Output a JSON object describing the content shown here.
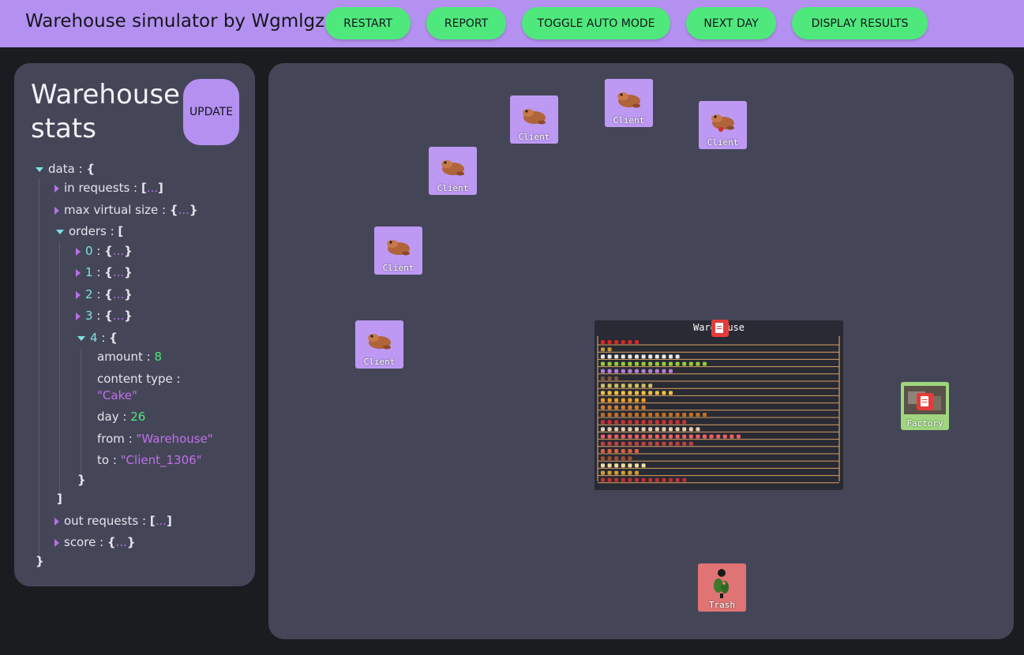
{
  "header": {
    "title": "Warehouse simulator by Wgmlgz",
    "buttons": {
      "restart": "RESTART",
      "report": "REPORT",
      "toggle_auto": "TOGGLE AUTO MODE",
      "next_day": "NEXT DAY",
      "display_results": "DISPLAY RESULTS"
    }
  },
  "stats": {
    "title": "Warehouse stats",
    "update_label": "UPDATE",
    "tree": {
      "data_key": "data",
      "in_requests_key": "in requests",
      "max_virtual_size_key": "max virtual size",
      "orders_key": "orders",
      "order_indexes": [
        "0",
        "1",
        "2",
        "3"
      ],
      "expanded_index": "4",
      "expanded_order": {
        "amount_key": "amount",
        "amount": "8",
        "content_type_key": "content type",
        "content_type": "\"Cake\"",
        "day_key": "day",
        "day": "26",
        "from_key": "from",
        "from": "\"Warehouse\"",
        "to_key": "to",
        "to": "\"Client_1306\""
      },
      "out_requests_key": "out requests",
      "score_key": "score"
    }
  },
  "canvas": {
    "client_label": "Client",
    "factory_label": "Factory",
    "trash_label": "Trash",
    "warehouse_label": "Warehouse"
  },
  "colors": {
    "header": "#b491f0",
    "button": "#4ee87c",
    "panel": "#444658",
    "client_tile": "#bd99f4",
    "factory_tile": "#9fd67e",
    "trash_tile": "#e07474"
  }
}
